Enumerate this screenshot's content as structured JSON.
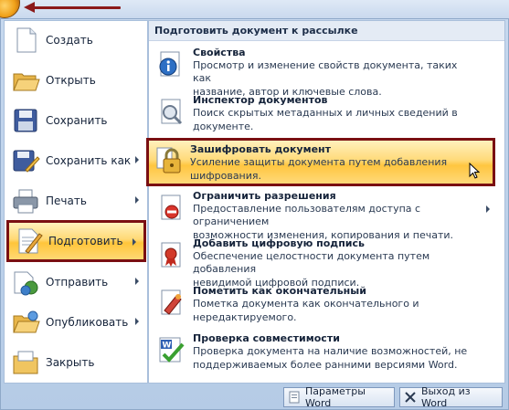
{
  "left_menu": {
    "items": [
      {
        "label": "Создать",
        "icon": "new-document-icon",
        "has_submenu": false
      },
      {
        "label": "Открыть",
        "icon": "open-folder-icon",
        "has_submenu": false
      },
      {
        "label": "Сохранить",
        "icon": "floppy-disk-icon",
        "has_submenu": false
      },
      {
        "label": "Сохранить как",
        "icon": "save-as-icon",
        "has_submenu": true
      },
      {
        "label": "Печать",
        "icon": "printer-icon",
        "has_submenu": true
      },
      {
        "label": "Подготовить",
        "icon": "prepare-icon",
        "has_submenu": true,
        "active": true
      },
      {
        "label": "Отправить",
        "icon": "send-icon",
        "has_submenu": true
      },
      {
        "label": "Опубликовать",
        "icon": "publish-icon",
        "has_submenu": true
      },
      {
        "label": "Закрыть",
        "icon": "close-folder-icon",
        "has_submenu": false
      }
    ]
  },
  "submenu": {
    "header": "Подготовить документ к рассылке",
    "items": [
      {
        "title": "Свойства",
        "desc1": "Просмотр и изменение свойств документа, таких как",
        "desc2": "название, автор и ключевые слова.",
        "icon": "properties-icon"
      },
      {
        "title": "Инспектор документов",
        "desc1": "Поиск скрытых метаданных и личных сведений в",
        "desc2": "документе.",
        "icon": "inspector-icon"
      },
      {
        "title": "Зашифровать документ",
        "desc1": "Усиление защиты документа путем добавления",
        "desc2": "шифрования.",
        "icon": "encrypt-lock-icon",
        "active": true
      },
      {
        "title": "Ограничить разрешения",
        "desc1": "Предоставление пользователям доступа с ограничением",
        "desc2": "возможности изменения, копирования и печати.",
        "icon": "restrict-permission-icon",
        "has_submenu": true
      },
      {
        "title": "Добавить цифровую подпись",
        "desc1": "Обеспечение целостности документа путем добавления",
        "desc2": "невидимой цифровой подписи.",
        "icon": "digital-signature-icon"
      },
      {
        "title": "Пометить как окончательный",
        "desc1": "Пометка документа как окончательного и",
        "desc2": "нередактируемого.",
        "icon": "mark-final-icon"
      },
      {
        "title": "Проверка совместимости",
        "desc1": "Проверка документа на наличие возможностей, не",
        "desc2": "поддерживаемых более ранними версиями Word.",
        "icon": "compatibility-check-icon"
      }
    ]
  },
  "footer": {
    "options_label": "Параметры Word",
    "exit_label": "Выход из Word"
  },
  "colors": {
    "highlight": "#ffd26a",
    "callout_border": "#7a0f12",
    "menu_background": "#c6d8ee"
  }
}
